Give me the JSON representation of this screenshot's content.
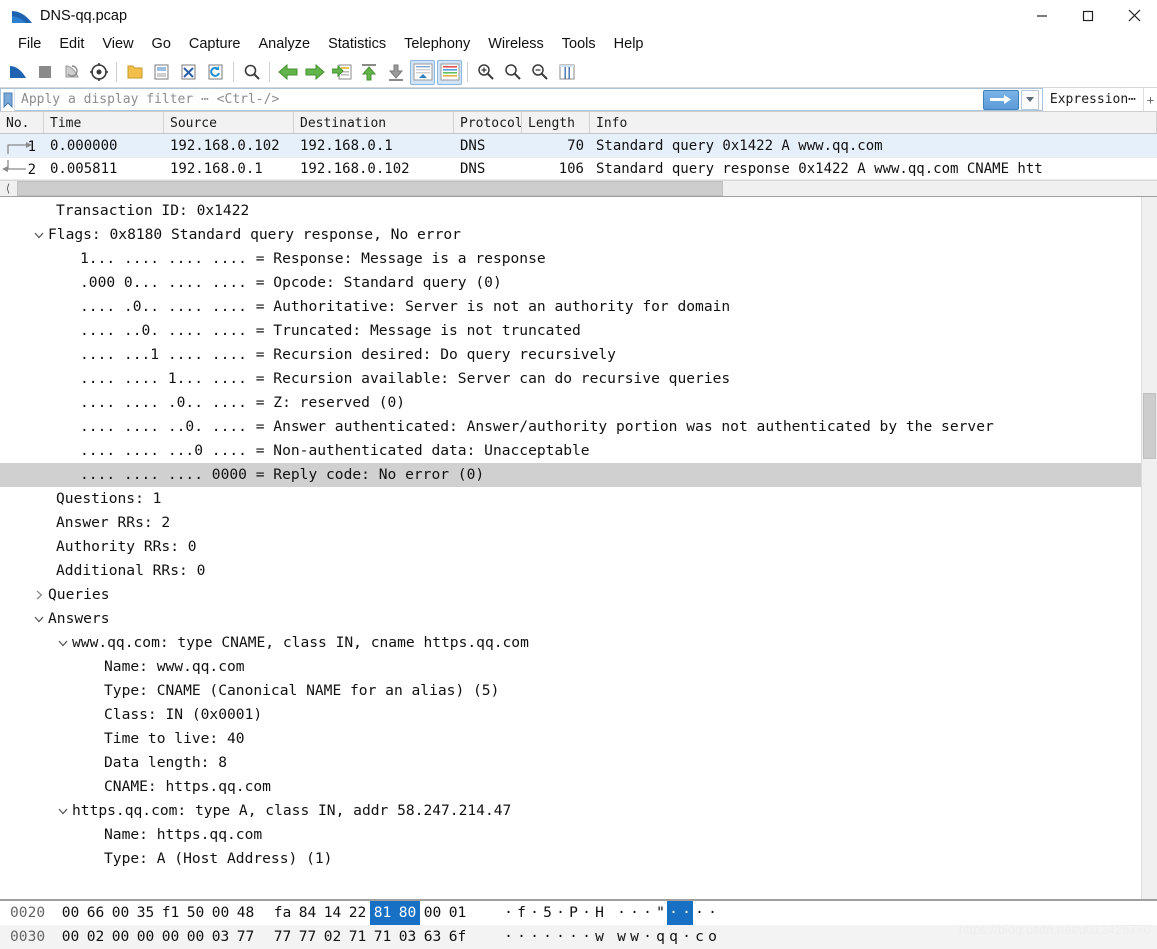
{
  "window": {
    "title": "DNS-qq.pcap",
    "app_icon": "wireshark-fin-icon",
    "minimize_label": "—",
    "maximize_label": "□",
    "close_label": "✕"
  },
  "menubar": {
    "items": [
      "File",
      "Edit",
      "View",
      "Go",
      "Capture",
      "Analyze",
      "Statistics",
      "Telephony",
      "Wireless",
      "Tools",
      "Help"
    ]
  },
  "toolbar": {
    "buttons": [
      {
        "name": "start-capture-icon",
        "active": false
      },
      {
        "name": "stop-capture-icon",
        "active": false
      },
      {
        "name": "restart-capture-icon",
        "active": false
      },
      {
        "name": "capture-options-icon",
        "active": false
      },
      {
        "name": "open-file-icon",
        "active": false
      },
      {
        "name": "save-file-icon",
        "active": false
      },
      {
        "name": "close-file-icon",
        "active": false
      },
      {
        "name": "reload-file-icon",
        "active": false
      },
      {
        "name": "find-packet-icon",
        "active": false
      },
      {
        "name": "go-back-icon",
        "active": false
      },
      {
        "name": "go-forward-icon",
        "active": false
      },
      {
        "name": "go-to-packet-icon",
        "active": false
      },
      {
        "name": "go-first-packet-icon",
        "active": false
      },
      {
        "name": "go-last-packet-icon",
        "active": false
      },
      {
        "name": "auto-scroll-icon",
        "active": true
      },
      {
        "name": "colorize-packets-icon",
        "active": true
      },
      {
        "name": "zoom-in-icon",
        "active": false
      },
      {
        "name": "zoom-out-icon",
        "active": false
      },
      {
        "name": "normal-size-icon",
        "active": false
      },
      {
        "name": "resize-columns-icon",
        "active": false
      }
    ]
  },
  "filter": {
    "bookmark_icon": "bookmark-icon",
    "placeholder": "Apply a display filter ⋯ <Ctrl-/>",
    "value": "",
    "apply_icon": "arrow-right-icon",
    "dropdown_icon": "chevron-down-icon",
    "expression_label": "Expression⋯",
    "tail_label": "+"
  },
  "packet_list": {
    "columns": [
      {
        "key": "no",
        "label": "No."
      },
      {
        "key": "time",
        "label": "Time"
      },
      {
        "key": "source",
        "label": "Source"
      },
      {
        "key": "destination",
        "label": "Destination"
      },
      {
        "key": "protocol",
        "label": "Protocol"
      },
      {
        "key": "length",
        "label": "Length"
      },
      {
        "key": "info",
        "label": "Info"
      }
    ],
    "rows": [
      {
        "no": "1",
        "time": "0.000000",
        "source": "192.168.0.102",
        "destination": "192.168.0.1",
        "protocol": "DNS",
        "length": "70",
        "info": "Standard query 0x1422 A www.qq.com",
        "selected": true,
        "marker": "request-arrow"
      },
      {
        "no": "2",
        "time": "0.005811",
        "source": "192.168.0.1",
        "destination": "192.168.0.102",
        "protocol": "DNS",
        "length": "106",
        "info": "Standard query response 0x1422 A www.qq.com CNAME htt",
        "selected": false,
        "marker": "response-arrow"
      }
    ]
  },
  "details": {
    "rows": [
      {
        "text": "Transaction ID: 0x1422",
        "indent": 1,
        "twisty": "none",
        "highlight": false
      },
      {
        "text": "Flags: 0x8180 Standard query response, No error",
        "indent": 1,
        "twisty": "open",
        "highlight": false
      },
      {
        "text": "1... .... .... .... = Response: Message is a response",
        "indent": 2,
        "twisty": "none",
        "highlight": false
      },
      {
        "text": ".000 0... .... .... = Opcode: Standard query (0)",
        "indent": 2,
        "twisty": "none",
        "highlight": false
      },
      {
        "text": ".... .0.. .... .... = Authoritative: Server is not an authority for domain",
        "indent": 2,
        "twisty": "none",
        "highlight": false
      },
      {
        "text": ".... ..0. .... .... = Truncated: Message is not truncated",
        "indent": 2,
        "twisty": "none",
        "highlight": false
      },
      {
        "text": ".... ...1 .... .... = Recursion desired: Do query recursively",
        "indent": 2,
        "twisty": "none",
        "highlight": false
      },
      {
        "text": ".... .... 1... .... = Recursion available: Server can do recursive queries",
        "indent": 2,
        "twisty": "none",
        "highlight": false
      },
      {
        "text": ".... .... .0.. .... = Z: reserved (0)",
        "indent": 2,
        "twisty": "none",
        "highlight": false
      },
      {
        "text": ".... .... ..0. .... = Answer authenticated: Answer/authority portion was not authenticated by the server",
        "indent": 2,
        "twisty": "none",
        "highlight": false
      },
      {
        "text": ".... .... ...0 .... = Non-authenticated data: Unacceptable",
        "indent": 2,
        "twisty": "none",
        "highlight": false
      },
      {
        "text": ".... .... .... 0000 = Reply code: No error (0)",
        "indent": 2,
        "twisty": "none",
        "highlight": true
      },
      {
        "text": "Questions: 1",
        "indent": 1,
        "twisty": "none",
        "highlight": false
      },
      {
        "text": "Answer RRs: 2",
        "indent": 1,
        "twisty": "none",
        "highlight": false
      },
      {
        "text": "Authority RRs: 0",
        "indent": 1,
        "twisty": "none",
        "highlight": false
      },
      {
        "text": "Additional RRs: 0",
        "indent": 1,
        "twisty": "none",
        "highlight": false
      },
      {
        "text": "Queries",
        "indent": 1,
        "twisty": "closed",
        "highlight": false
      },
      {
        "text": "Answers",
        "indent": 1,
        "twisty": "open",
        "highlight": false
      },
      {
        "text": "www.qq.com: type CNAME, class IN, cname https.qq.com",
        "indent": 2,
        "twisty": "open",
        "highlight": false
      },
      {
        "text": "Name: www.qq.com",
        "indent": 3,
        "twisty": "none",
        "highlight": false
      },
      {
        "text": "Type: CNAME (Canonical NAME for an alias) (5)",
        "indent": 3,
        "twisty": "none",
        "highlight": false
      },
      {
        "text": "Class: IN (0x0001)",
        "indent": 3,
        "twisty": "none",
        "highlight": false
      },
      {
        "text": "Time to live: 40",
        "indent": 3,
        "twisty": "none",
        "highlight": false
      },
      {
        "text": "Data length: 8",
        "indent": 3,
        "twisty": "none",
        "highlight": false
      },
      {
        "text": "CNAME: https.qq.com",
        "indent": 3,
        "twisty": "none",
        "highlight": false
      },
      {
        "text": "https.qq.com: type A, class IN, addr 58.247.214.47",
        "indent": 2,
        "twisty": "open",
        "highlight": false
      },
      {
        "text": "Name: https.qq.com",
        "indent": 3,
        "twisty": "none",
        "highlight": false
      },
      {
        "text": "Type: A (Host Address) (1)",
        "indent": 3,
        "twisty": "none",
        "highlight": false
      }
    ]
  },
  "hex_pane": {
    "rows": [
      {
        "offset": "0020",
        "bytes": [
          "00",
          "66",
          "00",
          "35",
          "f1",
          "50",
          "00",
          "48",
          "fa",
          "84",
          "14",
          "22",
          "81",
          "80",
          "00",
          "01"
        ],
        "highlight_bytes": [
          12,
          13
        ],
        "ascii": [
          "·",
          "f",
          "·",
          "5",
          "·",
          "P",
          "·",
          "H",
          "·",
          "·",
          "·",
          "\"",
          "·",
          "·",
          "·",
          "·"
        ],
        "highlight_ascii": [
          12,
          13
        ],
        "shaded": false
      },
      {
        "offset": "0030",
        "bytes": [
          "00",
          "02",
          "00",
          "00",
          "00",
          "00",
          "03",
          "77",
          "77",
          "77",
          "02",
          "71",
          "71",
          "03",
          "63",
          "6f"
        ],
        "highlight_bytes": [],
        "ascii": [
          "·",
          "·",
          "·",
          "·",
          "·",
          "·",
          "·",
          "w",
          "w",
          "w",
          "·",
          "q",
          "q",
          "·",
          "c",
          "o"
        ],
        "highlight_ascii": [],
        "shaded": true
      }
    ]
  },
  "watermark": {
    "text": "https://blog.csdn.net/u012425770"
  },
  "colors": {
    "selected_row": "#e6f0fb",
    "highlight_blue": "#1870c5",
    "tree_highlight": "#d0d0d0",
    "toolbar_active": "#cfe4f7"
  }
}
